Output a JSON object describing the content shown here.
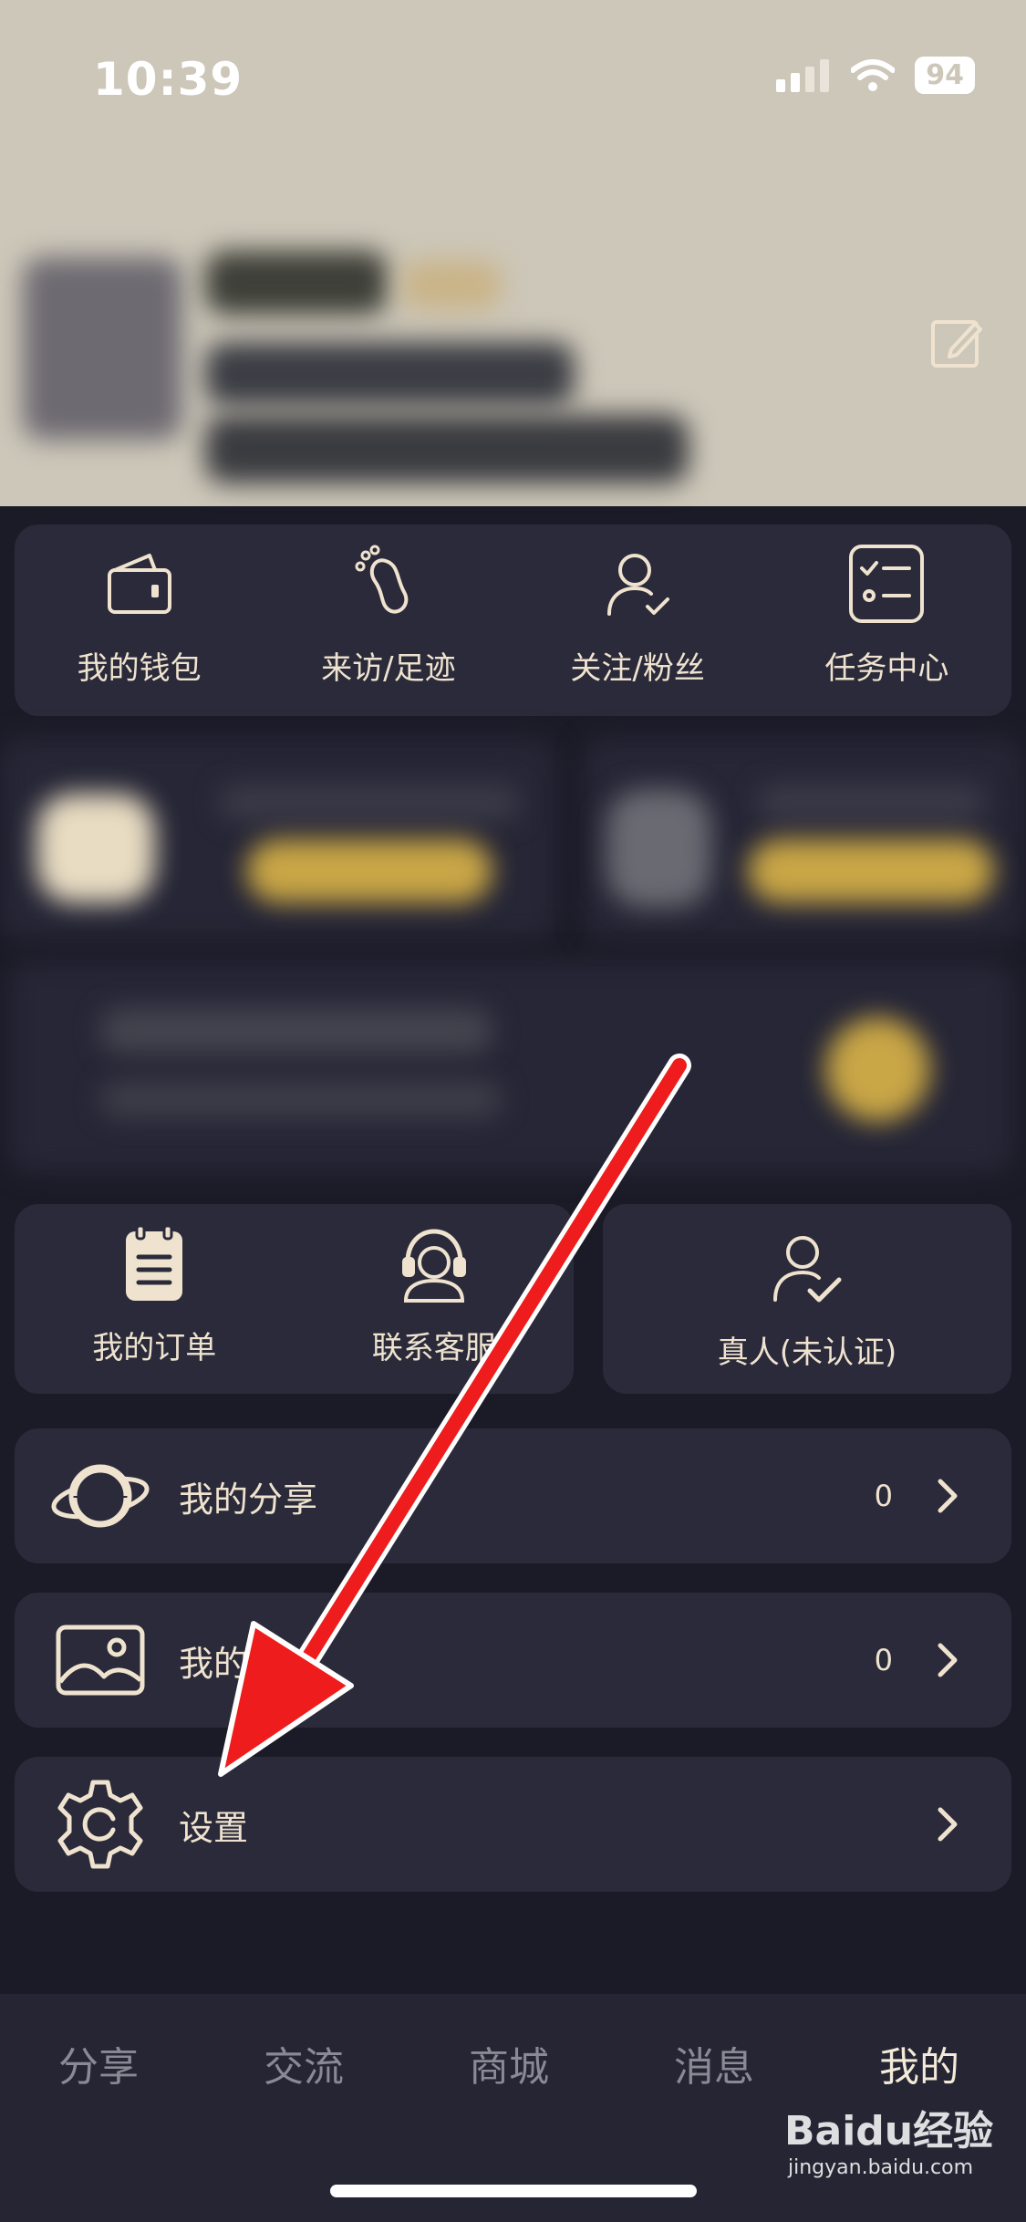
{
  "status": {
    "time": "10:39",
    "battery": "94"
  },
  "quick": [
    {
      "label": "我的钱包",
      "icon": "wallet-icon"
    },
    {
      "label": "来访/足迹",
      "icon": "footprint-icon"
    },
    {
      "label": "关注/粉丝",
      "icon": "follow-user-icon"
    },
    {
      "label": "任务中心",
      "icon": "task-list-icon"
    }
  ],
  "services": {
    "orders": {
      "label": "我的订单",
      "icon": "order-clipboard-icon"
    },
    "support": {
      "label": "联系客服",
      "icon": "headset-icon"
    },
    "verify": {
      "label": "真人(未认证)",
      "icon": "verify-user-icon"
    }
  },
  "list": [
    {
      "label": "我的分享",
      "count": "0",
      "icon": "planet-icon"
    },
    {
      "label": "我的相册",
      "count": "0",
      "icon": "photo-album-icon"
    },
    {
      "label": "设置",
      "count": "",
      "icon": "gear-icon"
    }
  ],
  "tabs": [
    "分享",
    "交流",
    "商城",
    "消息",
    "我的"
  ],
  "watermark": {
    "main": "Baidu经验",
    "sub": "jingyan.baidu.com"
  },
  "colors": {
    "accent": "#efe3cf",
    "card": "#2a2a3a",
    "background": "#1b1b27",
    "header": "#cdc7b9",
    "arrow": "#ee1c1c"
  }
}
